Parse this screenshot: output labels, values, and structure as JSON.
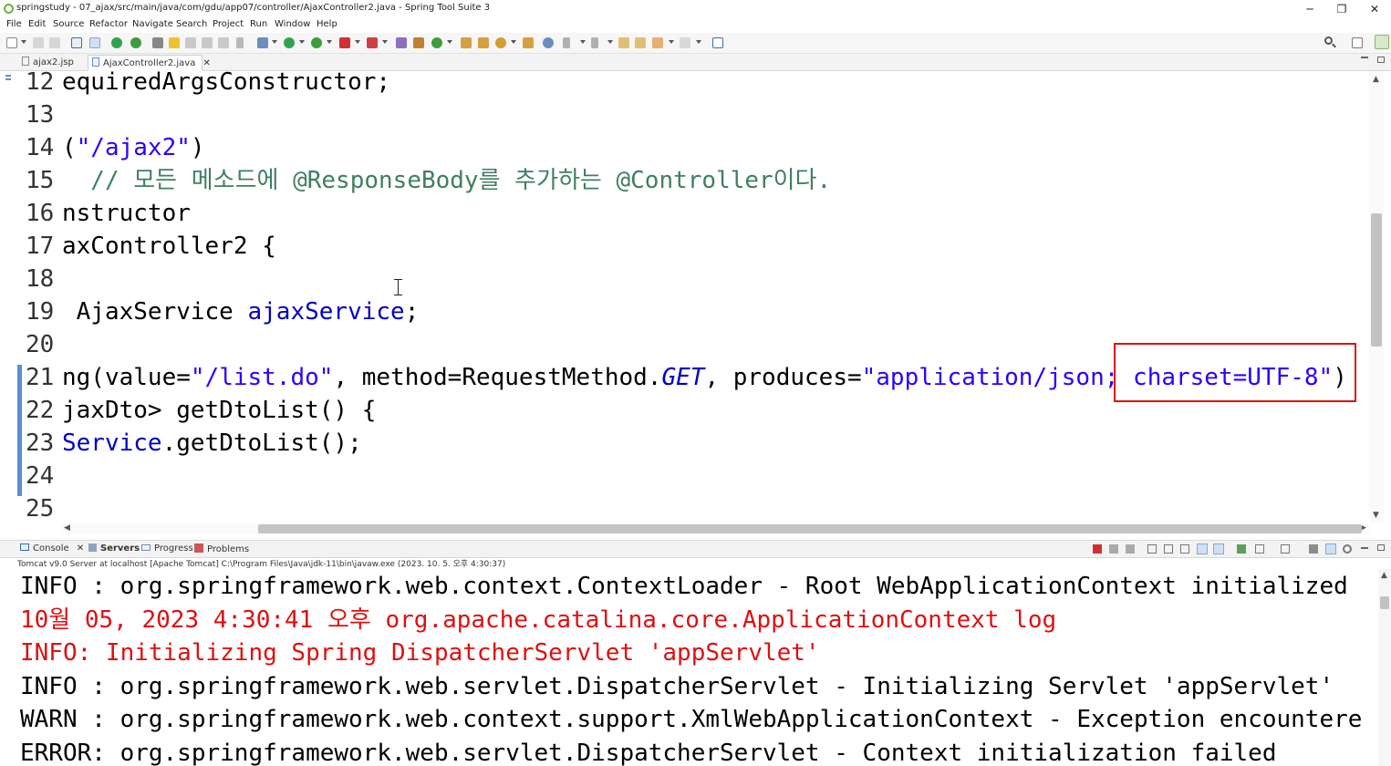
{
  "window": {
    "title": "springstudy - 07_ajax/src/main/java/com/gdu/app07/controller/AjaxController2.java - Spring Tool Suite 3",
    "controls": {
      "minimize": "─",
      "restore": "❐",
      "close": "✕"
    }
  },
  "menu": [
    "File",
    "Edit",
    "Source",
    "Refactor",
    "Navigate",
    "Search",
    "Project",
    "Run",
    "Window",
    "Help"
  ],
  "editor_tabs": [
    {
      "label": "ajax2.jsp",
      "active": false
    },
    {
      "label": "AjaxController2.java",
      "active": true,
      "close": "✕"
    }
  ],
  "code_lines": [
    {
      "num": "12",
      "parts": [
        {
          "t": "equiredArgsConstructor;",
          "c": "plain"
        }
      ]
    },
    {
      "num": "13",
      "parts": []
    },
    {
      "num": "14",
      "parts": [
        {
          "t": "(",
          "c": "plain"
        },
        {
          "t": "\"/ajax2\"",
          "c": "str"
        },
        {
          "t": ")",
          "c": "plain"
        }
      ]
    },
    {
      "num": "15",
      "parts": [
        {
          "t": "  // 모든 메소드에 @ResponseBody를 추가하는 @Controller이다.",
          "c": "com"
        }
      ]
    },
    {
      "num": "16",
      "parts": [
        {
          "t": "nstructor",
          "c": "plain"
        }
      ]
    },
    {
      "num": "17",
      "parts": [
        {
          "t": "axController2 {",
          "c": "plain"
        }
      ]
    },
    {
      "num": "18",
      "parts": []
    },
    {
      "num": "19",
      "parts": [
        {
          "t": " AjaxService ",
          "c": "plain"
        },
        {
          "t": "ajaxService",
          "c": "fld"
        },
        {
          "t": ";",
          "c": "plain"
        }
      ]
    },
    {
      "num": "20",
      "parts": []
    },
    {
      "num": "21",
      "parts": [
        {
          "t": "ng(value=",
          "c": "plain"
        },
        {
          "t": "\"/list.do\"",
          "c": "str"
        },
        {
          "t": ", method=RequestMethod.",
          "c": "plain"
        },
        {
          "t": "GET",
          "c": "ital"
        },
        {
          "t": ", produces=",
          "c": "plain"
        },
        {
          "t": "\"application/json; charset=UTF-8\"",
          "c": "str"
        },
        {
          "t": ")",
          "c": "plain"
        }
      ]
    },
    {
      "num": "22",
      "parts": [
        {
          "t": "jaxDto> getDtoList() {",
          "c": "plain"
        }
      ]
    },
    {
      "num": "23",
      "parts": [
        {
          "t": "Service",
          "c": "fld"
        },
        {
          "t": ".getDtoList();",
          "c": "plain"
        }
      ]
    },
    {
      "num": "24",
      "parts": []
    },
    {
      "num": "25",
      "parts": []
    }
  ],
  "panel_tabs": [
    {
      "label": "Console",
      "close": "✕"
    },
    {
      "label": "Servers"
    },
    {
      "label": "Progress"
    },
    {
      "label": "Problems"
    }
  ],
  "server_info": "Tomcat v9.0 Server at localhost [Apache Tomcat] C:\\Program Files\\Java\\jdk-11\\bin\\javaw.exe  (2023. 10. 5. 오후 4:30:37)",
  "console_lines": [
    {
      "text": "INFO : org.springframework.web.context.ContextLoader - Root WebApplicationContext initialized",
      "color": "black"
    },
    {
      "text": "10월 05, 2023 4:30:41 오후 org.apache.catalina.core.ApplicationContext log",
      "color": "red"
    },
    {
      "text": "INFO: Initializing Spring DispatcherServlet 'appServlet'",
      "color": "red"
    },
    {
      "text": "INFO : org.springframework.web.servlet.DispatcherServlet - Initializing Servlet 'appServlet'",
      "color": "black"
    },
    {
      "text": "WARN : org.springframework.web.context.support.XmlWebApplicationContext - Exception encountere",
      "color": "black"
    },
    {
      "text": "ERROR: org.springframework.web.servlet.DispatcherServlet - Context initialization failed",
      "color": "black"
    }
  ],
  "icons": [
    "spring-logo-icon",
    "search-icon",
    "perspective-icon",
    "java-file-icon",
    "jsp-file-icon",
    "console-icon",
    "servers-icon",
    "progress-icon",
    "problems-icon"
  ],
  "colors": {
    "string": "#2a00ff",
    "comment": "#3f7f5f",
    "field": "#0000c0",
    "error_text": "#dd1010",
    "highlight_box": "#e01010"
  }
}
